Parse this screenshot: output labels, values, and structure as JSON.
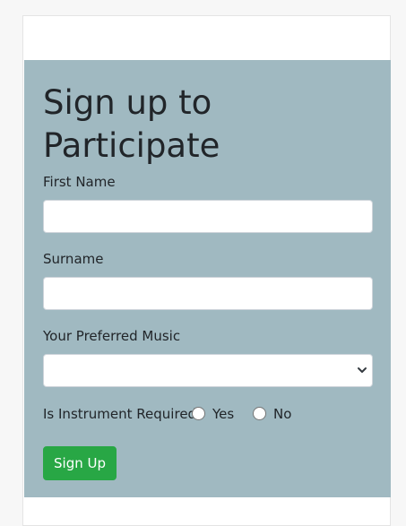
{
  "form": {
    "title_line1": "Sign up to",
    "title_line2": "Participate",
    "first_name_label": "First Name",
    "first_name_value": "",
    "surname_label": "Surname",
    "surname_value": "",
    "music_label": "Your Preferred Music",
    "music_selected": "",
    "instrument_question": "Is Instrument Required",
    "options": {
      "yes": "Yes",
      "no": "No"
    },
    "submit_label": "Sign Up"
  },
  "colors": {
    "panel_background": "#a0b9c1",
    "submit_button": "#28a745"
  },
  "icons": {
    "select_arrow": "chevron-down-icon"
  }
}
